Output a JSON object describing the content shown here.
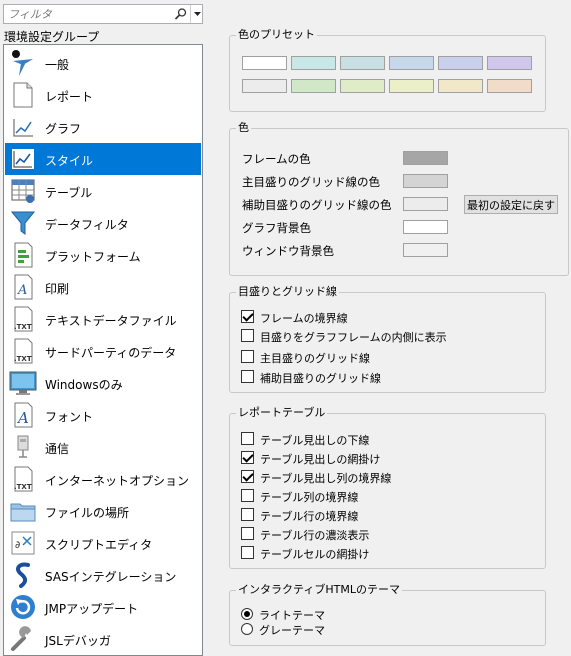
{
  "filter": {
    "placeholder": "フィルタ"
  },
  "group_title": "環境設定グループ",
  "sidebar": {
    "items": [
      {
        "label": "一般",
        "icon": "general-icon",
        "selected": false
      },
      {
        "label": "レポート",
        "icon": "report-icon",
        "selected": false
      },
      {
        "label": "グラフ",
        "icon": "graph-icon",
        "selected": false
      },
      {
        "label": "スタイル",
        "icon": "style-icon",
        "selected": true
      },
      {
        "label": "テーブル",
        "icon": "table-icon",
        "selected": false
      },
      {
        "label": "データフィルタ",
        "icon": "data-filter-icon",
        "selected": false
      },
      {
        "label": "プラットフォーム",
        "icon": "platform-icon",
        "selected": false
      },
      {
        "label": "印刷",
        "icon": "print-icon",
        "selected": false
      },
      {
        "label": "テキストデータファイル",
        "icon": "text-file-icon",
        "selected": false
      },
      {
        "label": "サードパーティのデータ",
        "icon": "third-party-icon",
        "selected": false
      },
      {
        "label": "Windowsのみ",
        "icon": "monitor-icon",
        "selected": false
      },
      {
        "label": "フォント",
        "icon": "font-icon",
        "selected": false
      },
      {
        "label": "通信",
        "icon": "communication-icon",
        "selected": false
      },
      {
        "label": "インターネットオプション",
        "icon": "internet-icon",
        "selected": false
      },
      {
        "label": "ファイルの場所",
        "icon": "folder-icon",
        "selected": false
      },
      {
        "label": "スクリプトエディタ",
        "icon": "script-editor-icon",
        "selected": false
      },
      {
        "label": "SASインテグレーション",
        "icon": "sas-icon",
        "selected": false
      },
      {
        "label": "JMPアップデート",
        "icon": "update-icon",
        "selected": false
      },
      {
        "label": "JSLデバッガ",
        "icon": "debugger-icon",
        "selected": false
      }
    ]
  },
  "presets": {
    "title": "色のプリセット",
    "row1": [
      "#ffffff",
      "#c8e8e8",
      "#c8e0e4",
      "#c8d8ec",
      "#c8d0ec",
      "#d0c8ec"
    ],
    "row2": [
      "#ececec",
      "#d0e8c8",
      "#e0ecc8",
      "#ecf0c8",
      "#f0e8c8",
      "#f0dcc8"
    ]
  },
  "colors": {
    "title": "色",
    "rows": [
      {
        "label": "フレームの色",
        "color": "#a6a6a6"
      },
      {
        "label": "主目盛りのグリッド線の色",
        "color": "#d4d4d4"
      },
      {
        "label": "補助目盛りのグリッド線の色",
        "color": "#ececec"
      },
      {
        "label": "グラフ背景色",
        "color": "#ffffff"
      },
      {
        "label": "ウィンドウ背景色",
        "color": "#f0f0f0"
      }
    ],
    "reset_button": "最初の設定に戻す"
  },
  "ticks": {
    "title": "目盛りとグリッド線",
    "options": [
      {
        "label": "フレームの境界線",
        "checked": true
      },
      {
        "label": "目盛りをグラフフレームの内側に表示",
        "checked": false
      },
      {
        "label": "主目盛りのグリッド線",
        "checked": false
      },
      {
        "label": "補助目盛りのグリッド線",
        "checked": false
      }
    ]
  },
  "report_table": {
    "title": "レポートテーブル",
    "options": [
      {
        "label": "テーブル見出しの下線",
        "checked": false
      },
      {
        "label": "テーブル見出しの網掛け",
        "checked": true
      },
      {
        "label": "テーブル見出し列の境界線",
        "checked": true
      },
      {
        "label": "テーブル列の境界線",
        "checked": false
      },
      {
        "label": "テーブル行の境界線",
        "checked": false
      },
      {
        "label": "テーブル行の濃淡表示",
        "checked": false
      },
      {
        "label": "テーブルセルの網掛け",
        "checked": false
      }
    ]
  },
  "html_theme": {
    "title": "インタラクティブHTMLのテーマ",
    "options": [
      {
        "label": "ライトテーマ",
        "selected": true
      },
      {
        "label": "グレーテーマ",
        "selected": false
      }
    ]
  }
}
